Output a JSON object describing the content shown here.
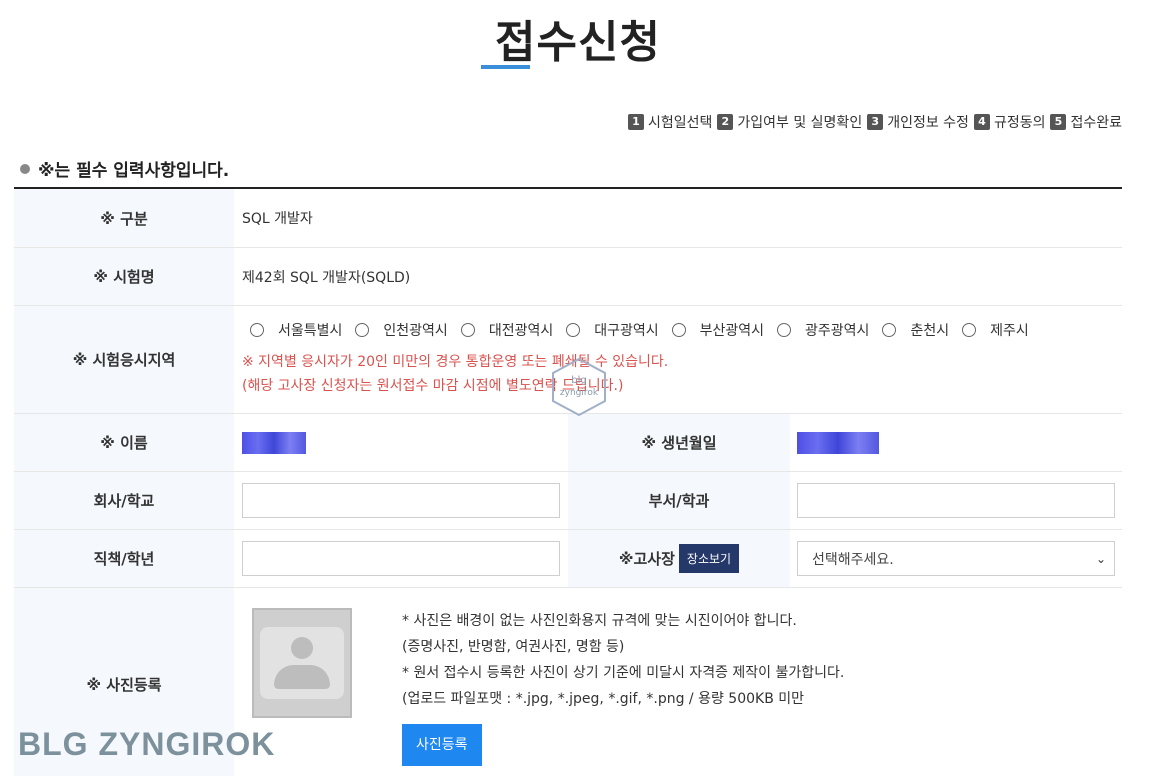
{
  "page": {
    "title": "접수신청"
  },
  "steps": [
    {
      "num": "1",
      "label": "시험일선택"
    },
    {
      "num": "2",
      "label": "가입여부 및 실명확인"
    },
    {
      "num": "3",
      "label": "개인정보 수정"
    },
    {
      "num": "4",
      "label": "규정동의"
    },
    {
      "num": "5",
      "label": "접수완료"
    }
  ],
  "required_note": "※는 필수 입력사항입니다.",
  "form": {
    "category": {
      "label": "※ 구분",
      "value": "SQL 개발자"
    },
    "exam_name": {
      "label": "※ 시험명",
      "value": "제42회 SQL 개발자(SQLD)"
    },
    "region": {
      "label": "※ 시험응시지역",
      "options": [
        "서울특별시",
        "인천광역시",
        "대전광역시",
        "대구광역시",
        "부산광역시",
        "광주광역시",
        "춘천시",
        "제주시"
      ],
      "warning1": "※ 지역별 응시자가 20인 미만의 경우 통합운영 또는 폐쇄될 수 있습니다.",
      "warning2": "(해당 고사장 신청자는 원서접수 마감 시점에 별도연락 드립니다.)"
    },
    "name": {
      "label": "※ 이름"
    },
    "birth": {
      "label": "※ 생년월일"
    },
    "company": {
      "label": "회사/학교"
    },
    "department": {
      "label": "부서/학과"
    },
    "position": {
      "label": "직책/학년"
    },
    "venue": {
      "label": "※고사장",
      "button": "장소보기",
      "selected": "선택해주세요."
    },
    "photo": {
      "label": "※ 사진등록",
      "note1": "* 사진은 배경이 없는 사진인화용지 규격에 맞는 시진이어야 합니다.",
      "note2": "(증명사진, 반명함, 여권사진, 명함 등)",
      "note3": "* 원서 접수시 등록한 사진이 상기 기준에 미달시 자격증 제작이 불가합니다.",
      "note4": "(업로드 파일포맷 : *.jpg, *.jpeg, *.gif, *.png / 용량 500KB 미만",
      "button": "사진등록"
    }
  },
  "watermark": "BLG ZYNGIROK",
  "stamp": {
    "line1": "blg",
    "line2": "zyngirok"
  },
  "colors": {
    "accent": "#3a8fd8",
    "warning": "#d9534f",
    "button_blue": "#1e88f0",
    "navy": "#24386a"
  }
}
